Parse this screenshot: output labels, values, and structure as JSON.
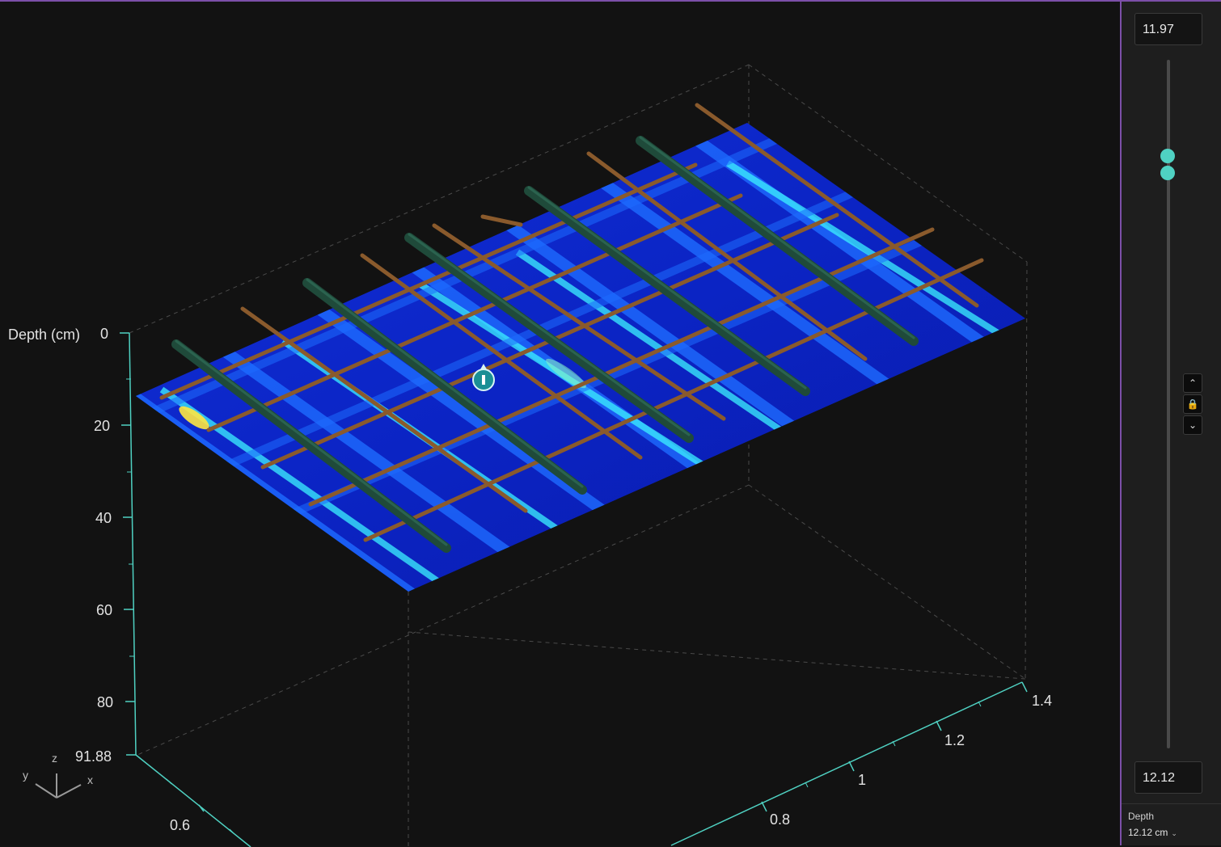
{
  "viewport": {
    "depth_axis": {
      "label": "Depth (cm)",
      "ticks": [
        "0",
        "20",
        "40",
        "60",
        "80",
        "91.88"
      ]
    },
    "x_axis": {
      "ticks": [
        "0.8",
        "1",
        "1.2",
        "1.4"
      ]
    },
    "y_axis": {
      "ticks": [
        "0.6"
      ]
    },
    "orientation": {
      "z": "z",
      "y": "y",
      "x": "x"
    },
    "colors": {
      "scan_low": "#0a1aa8",
      "scan_mid": "#1e6cff",
      "scan_high": "#3cf2ff",
      "hot": "#ffe640",
      "thin_rebar": "#8a5a2c",
      "thick_rebar": "#1f4a3a",
      "axis": "#4fd1c2"
    }
  },
  "side_panel": {
    "top_value": "11.97",
    "bottom_value": "12.12",
    "slider_top_fraction": 0.14,
    "slider_bottom_fraction": 0.155,
    "depth_label": "Depth",
    "depth_value": "12.12 cm"
  }
}
